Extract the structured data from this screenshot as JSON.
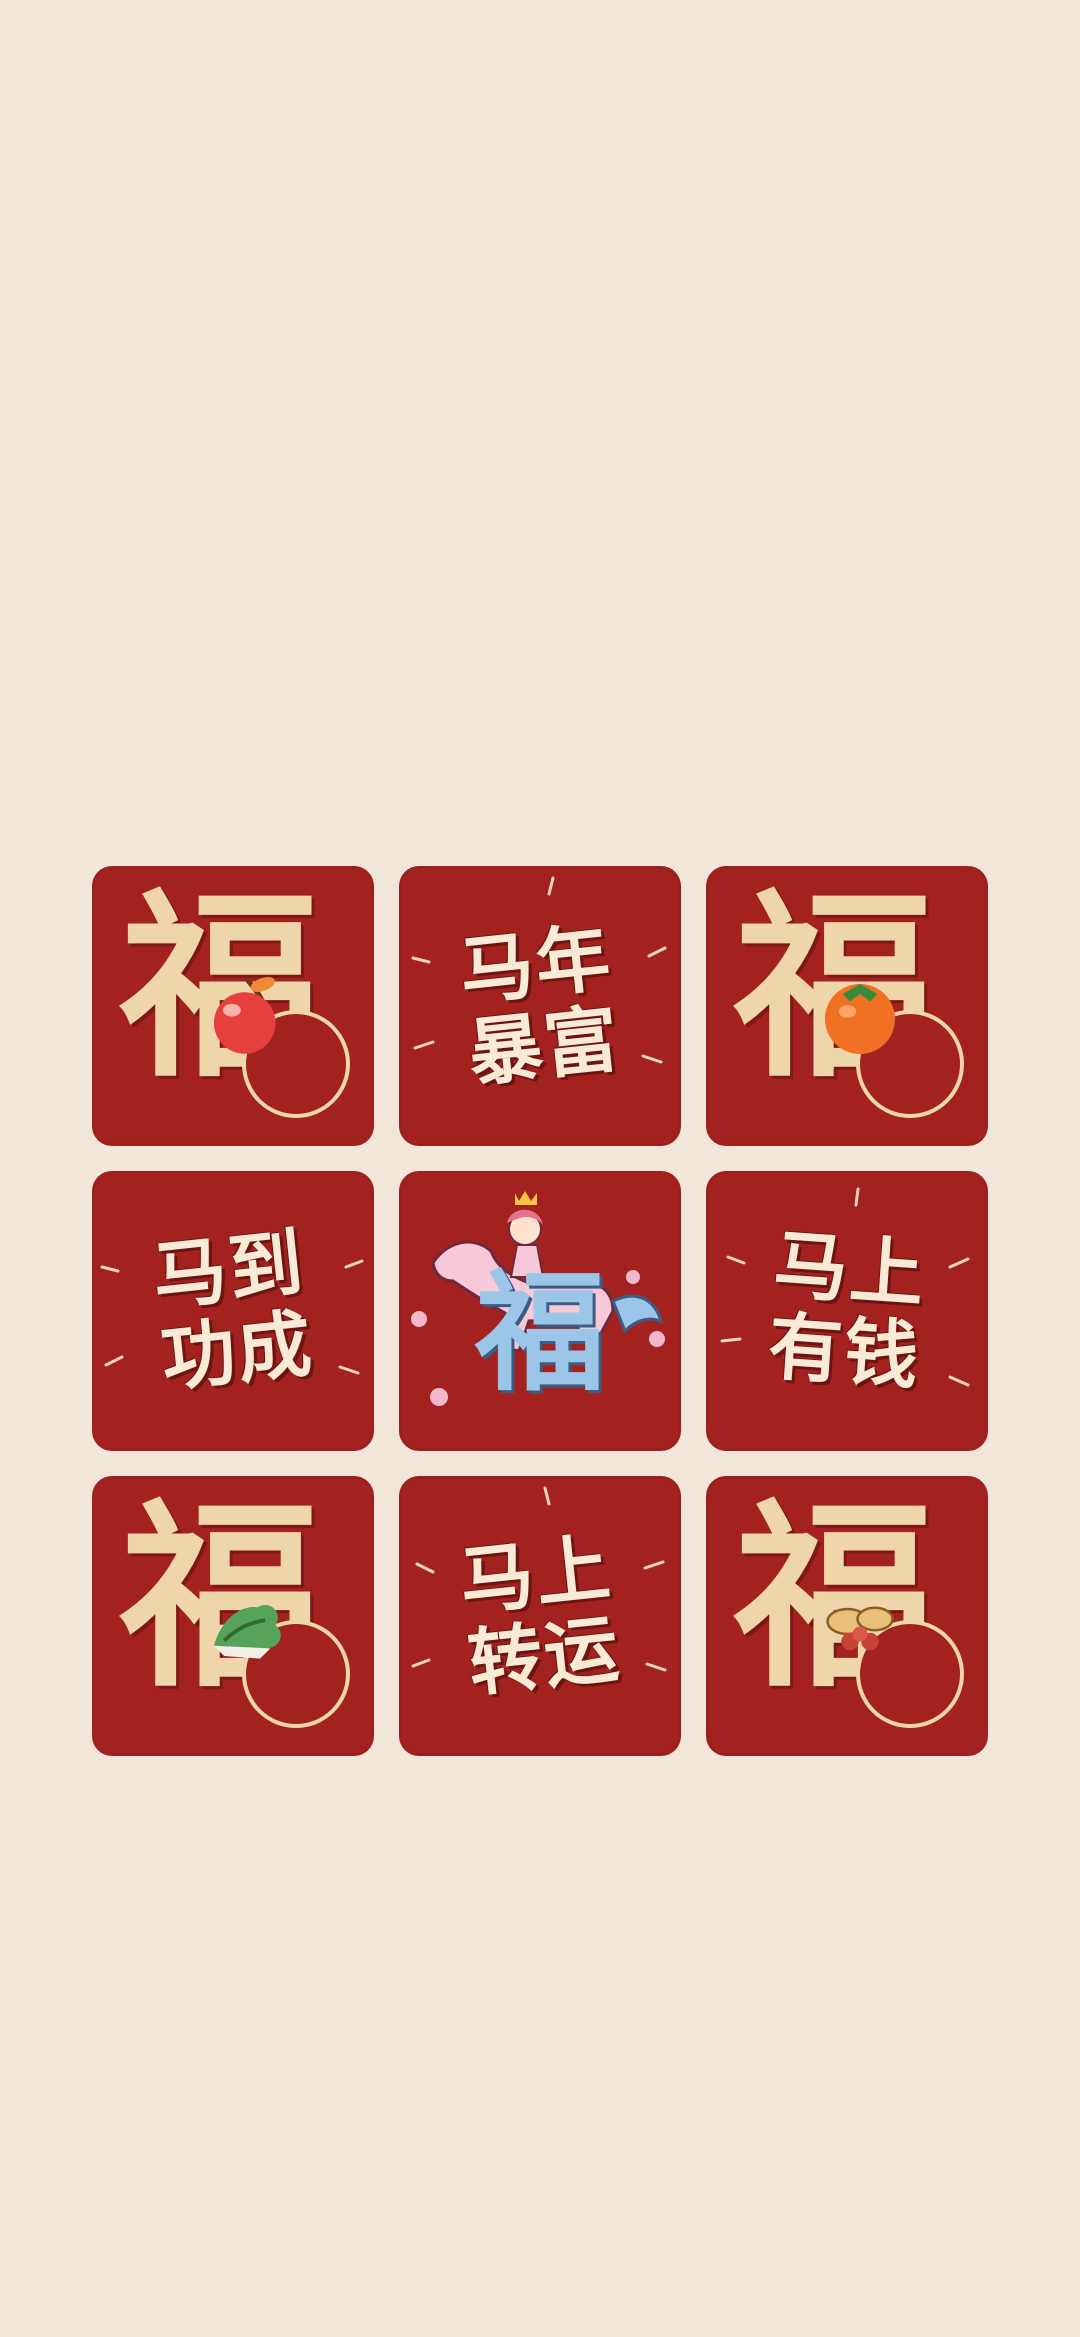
{
  "background_color": "#f2e6db",
  "tile_color": "#a3221f",
  "accent_gold": "#efd6aa",
  "tiles": [
    {
      "type": "fu",
      "glyph": "福",
      "icon": "cherry-icon"
    },
    {
      "type": "slogan",
      "line1": "马年",
      "line2": "暴富"
    },
    {
      "type": "fu",
      "glyph": "福",
      "icon": "persimmon-icon"
    },
    {
      "type": "slogan",
      "line1": "马到",
      "line2": "功成"
    },
    {
      "type": "horse",
      "glyph": "福",
      "icon": "horse-rider-icon"
    },
    {
      "type": "slogan",
      "line1": "马上",
      "line2": "有钱"
    },
    {
      "type": "fu",
      "glyph": "福",
      "icon": "leafy-greens-icon"
    },
    {
      "type": "slogan",
      "line1": "马上",
      "line2": "转运"
    },
    {
      "type": "fu",
      "glyph": "福",
      "icon": "peanuts-icon"
    }
  ]
}
